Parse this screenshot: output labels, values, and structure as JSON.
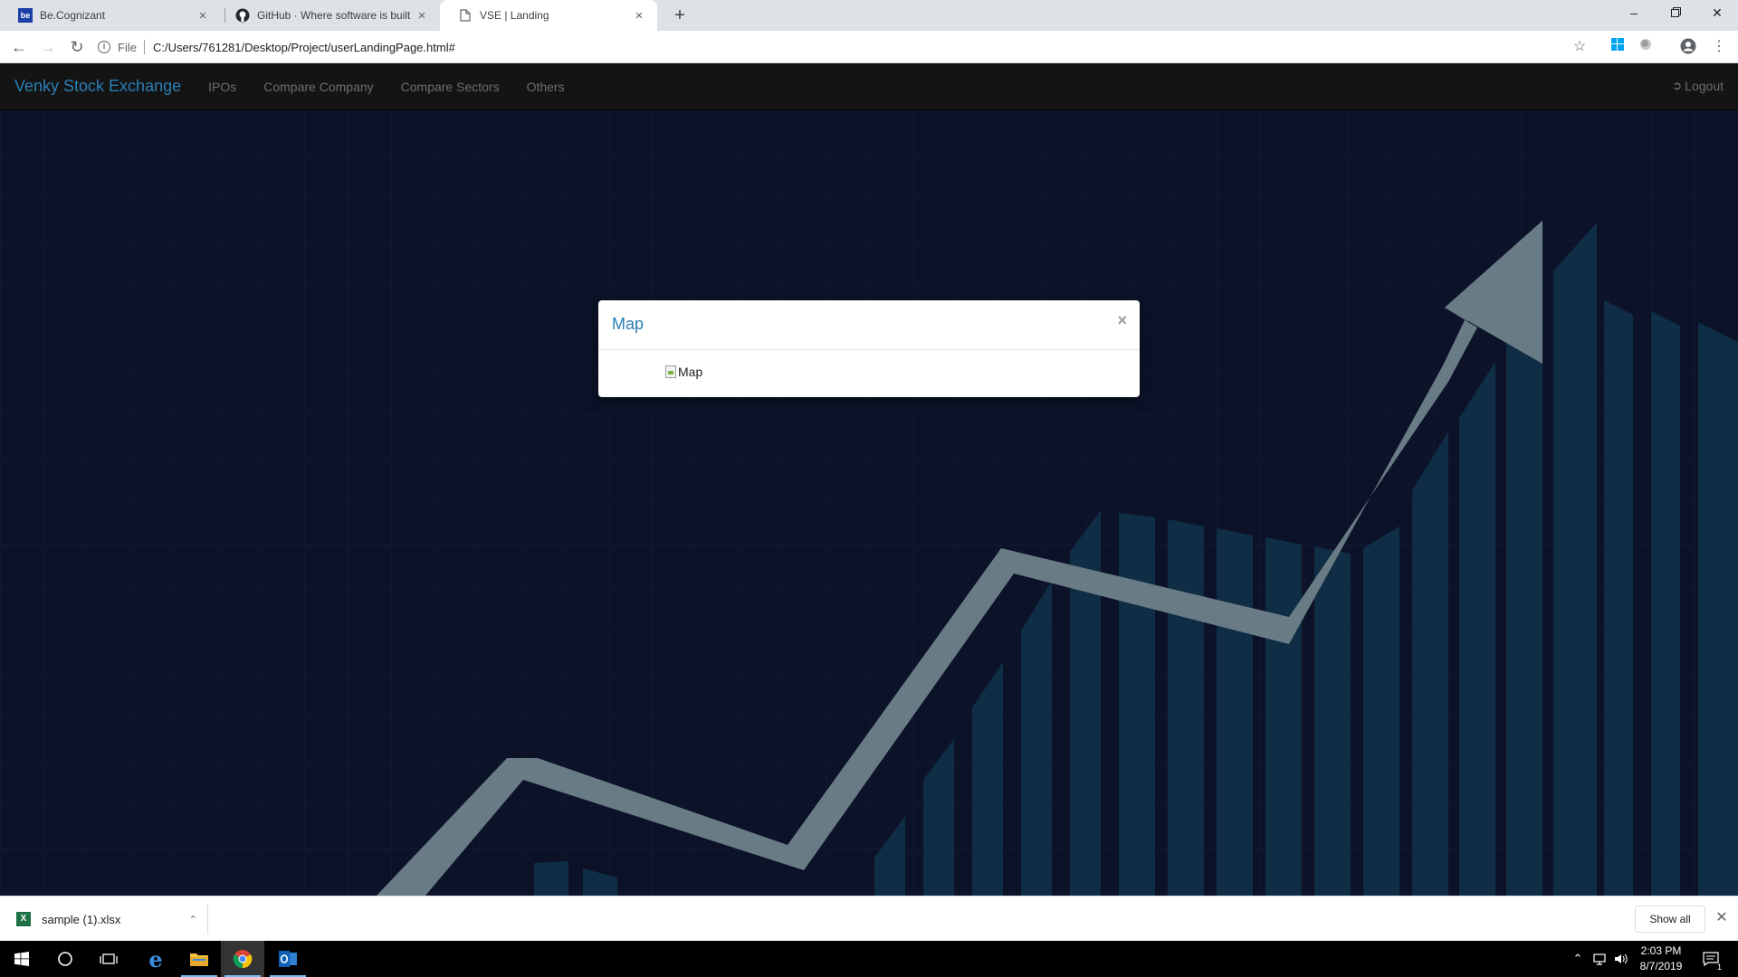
{
  "browser": {
    "tabs": [
      {
        "title": "Be.Cognizant",
        "icon": "be-icon",
        "active": false
      },
      {
        "title": "GitHub · Where software is built",
        "icon": "github-icon",
        "active": false
      },
      {
        "title": "VSE | Landing",
        "icon": "page-icon",
        "active": true
      }
    ],
    "new_tab_symbol": "+",
    "url_scheme_label": "File",
    "url": "C:/Users/761281/Desktop/Project/userLandingPage.html#"
  },
  "navbar": {
    "brand": "Venky Stock Exchange",
    "links": [
      "IPOs",
      "Compare Company",
      "Compare Sectors",
      "Others"
    ],
    "logout": "Logout"
  },
  "modal": {
    "title": "Map",
    "close_symbol": "×",
    "image_alt": "Map"
  },
  "download_shelf": {
    "file_name": "sample (1).xlsx",
    "show_all": "Show all"
  },
  "taskbar": {
    "time": "2:03 PM",
    "date": "8/7/2019",
    "notification_count": "1"
  },
  "colors": {
    "page_bg": "#0c1329",
    "navbar_bg": "#141414",
    "brand_blue": "#2a7fb5",
    "arrow": "#697b84",
    "bars": "#0f2d45"
  }
}
